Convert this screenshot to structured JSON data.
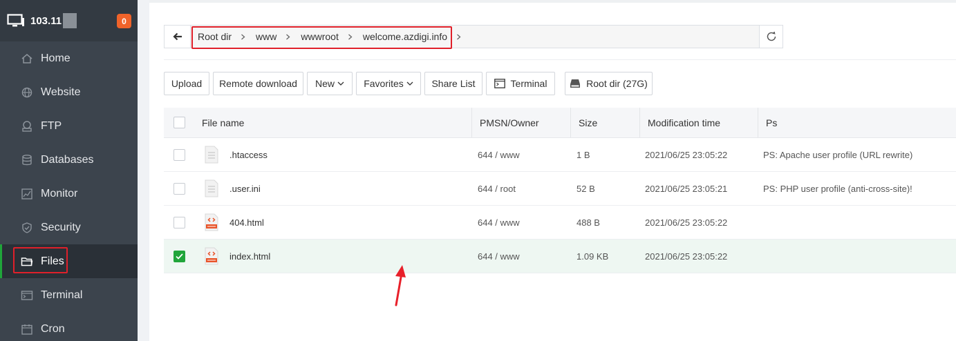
{
  "sidebar": {
    "server_ip": "103.11",
    "badge": "0",
    "items": [
      {
        "label": "Home",
        "icon": "home-icon"
      },
      {
        "label": "Website",
        "icon": "globe-icon"
      },
      {
        "label": "FTP",
        "icon": "ftp-icon"
      },
      {
        "label": "Databases",
        "icon": "database-icon"
      },
      {
        "label": "Monitor",
        "icon": "monitor-chart-icon"
      },
      {
        "label": "Security",
        "icon": "shield-icon"
      },
      {
        "label": "Files",
        "icon": "folder-icon",
        "active": true
      },
      {
        "label": "Terminal",
        "icon": "terminal-icon"
      },
      {
        "label": "Cron",
        "icon": "calendar-icon"
      }
    ]
  },
  "path": {
    "crumbs": [
      "Root dir",
      "www",
      "wwwroot",
      "welcome.azdigi.info"
    ]
  },
  "toolbar": {
    "upload": "Upload",
    "remote_download": "Remote download",
    "new": "New",
    "favorites": "Favorites",
    "share_list": "Share List",
    "terminal": "Terminal",
    "root_dir": "Root dir (27G)"
  },
  "table": {
    "headers": {
      "name": "File name",
      "perm": "PMSN/Owner",
      "size": "Size",
      "mod": "Modification time",
      "ps": "Ps"
    },
    "rows": [
      {
        "name": ".htaccess",
        "perm": "644 / www",
        "size": "1 B",
        "mod": "2021/06/25 23:05:22",
        "ps": "PS: Apache user profile (URL rewrite)",
        "icon": "text-file-icon",
        "checked": false
      },
      {
        "name": ".user.ini",
        "perm": "644 / root",
        "size": "52 B",
        "mod": "2021/06/25 23:05:21",
        "ps": "PS: PHP user profile (anti-cross-site)!",
        "icon": "text-file-icon",
        "checked": false
      },
      {
        "name": "404.html",
        "perm": "644 / www",
        "size": "488 B",
        "mod": "2021/06/25 23:05:22",
        "ps": "",
        "icon": "html-file-icon",
        "checked": false
      },
      {
        "name": "index.html",
        "perm": "644 / www",
        "size": "1.09 KB",
        "mod": "2021/06/25 23:05:22",
        "ps": "",
        "icon": "html-file-icon",
        "checked": true
      }
    ]
  },
  "colors": {
    "sidebar_bg": "#3c444d",
    "accent_green": "#20a53a",
    "badge_orange": "#f0632a",
    "highlight_red": "#e0202a"
  }
}
